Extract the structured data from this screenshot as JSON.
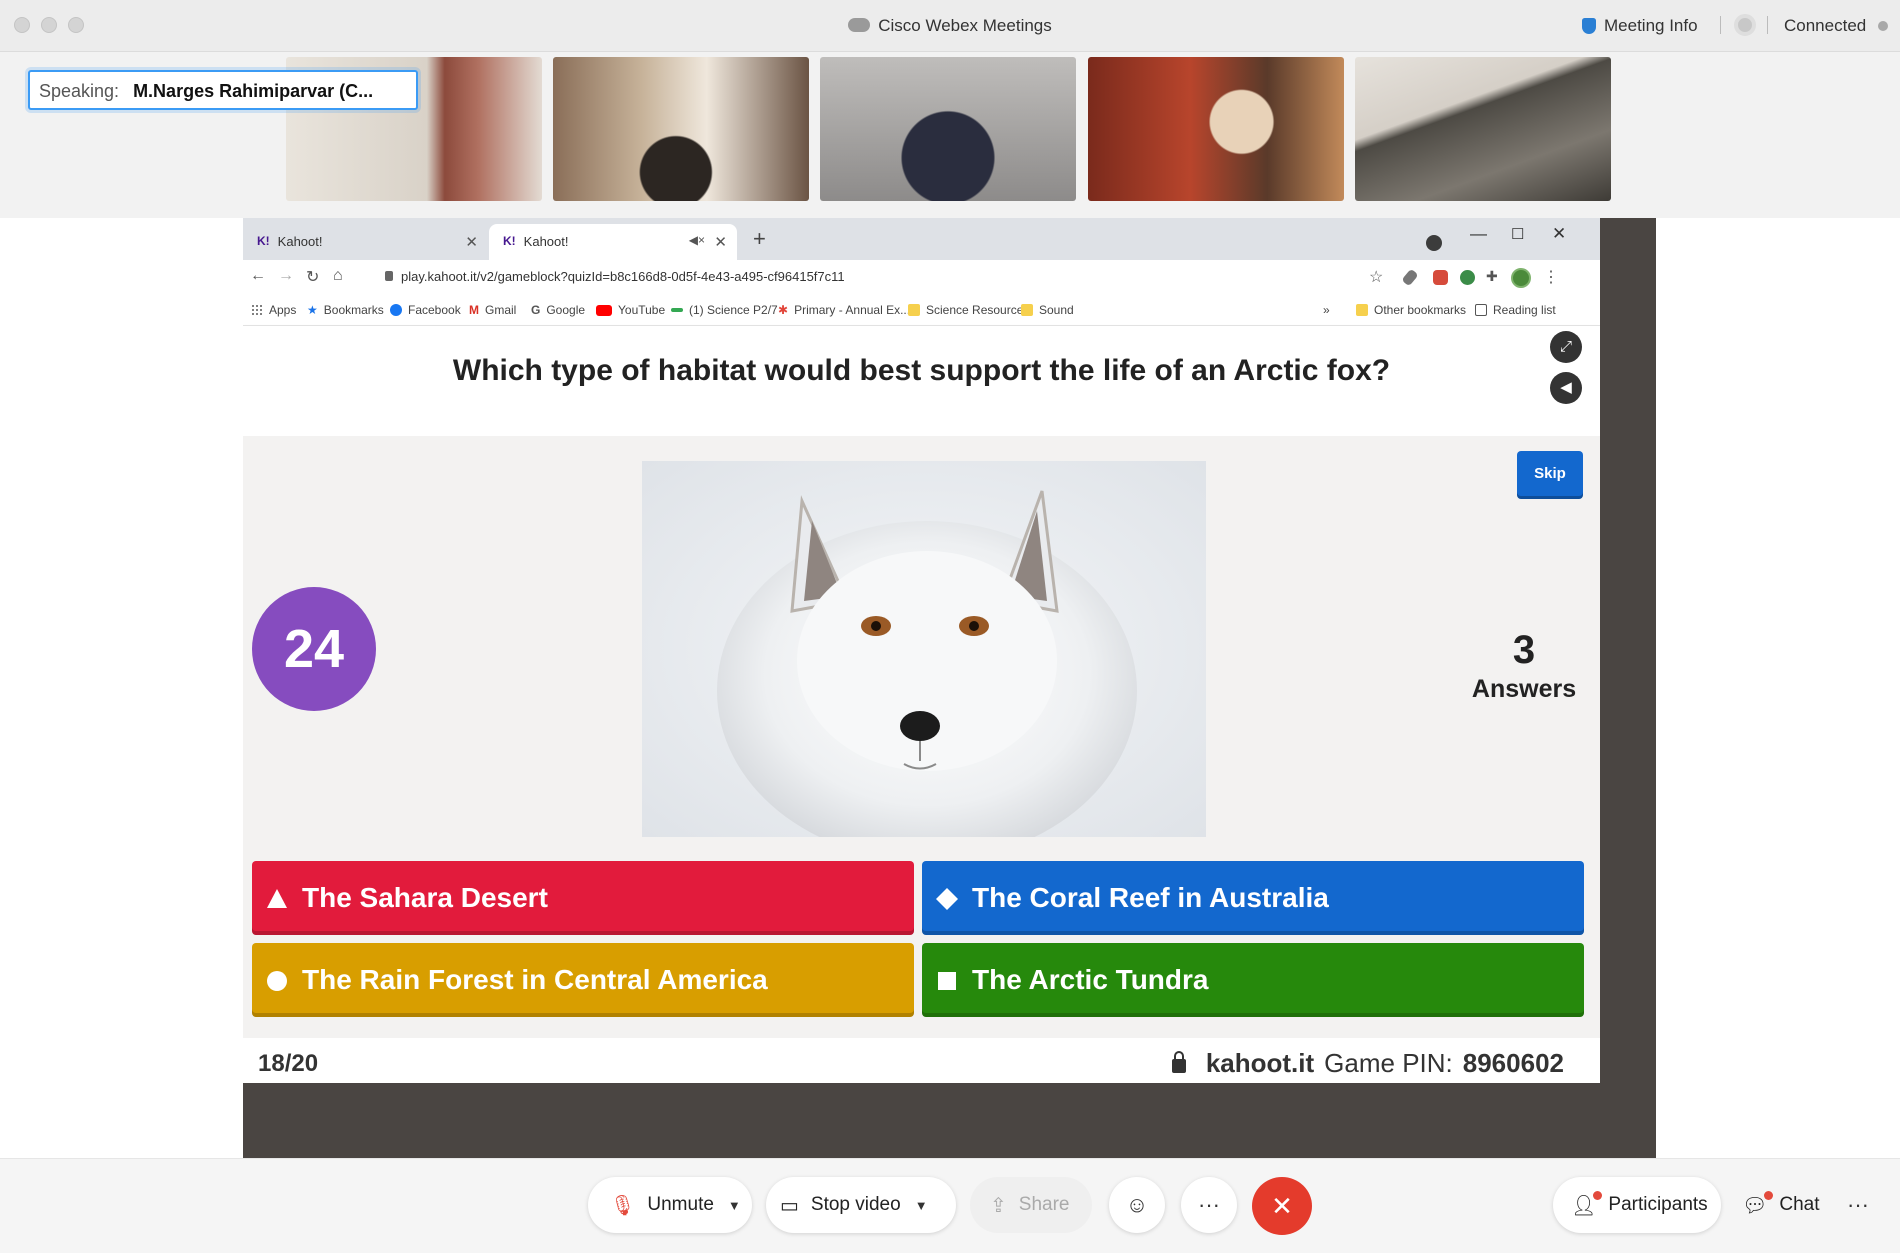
{
  "window": {
    "title": "Cisco Webex Meetings",
    "meeting_info_label": "Meeting Info",
    "status": "Connected"
  },
  "speaking": {
    "label": "Speaking:",
    "name": "M.Narges Rahimiparvar (C..."
  },
  "browser": {
    "tabs": [
      {
        "label": "Kahoot!"
      },
      {
        "label": "Kahoot!"
      }
    ],
    "url": "play.kahoot.it/v2/gameblock?quizId=b8c166d8-0d5f-4e43-a495-cf96415f7c11",
    "bookmarks": [
      "Apps",
      "Bookmarks",
      "Facebook",
      "Gmail",
      "Google",
      "YouTube",
      "(1) Science P2/7",
      "Primary - Annual Ex...",
      "Science Resource",
      "Sound"
    ],
    "bookmarks_more": "»",
    "other_bookmarks": "Other bookmarks",
    "reading_list": "Reading list"
  },
  "kahoot": {
    "question": "Which type of habitat would best support the life of an Arctic fox?",
    "timer": "24",
    "skip_label": "Skip",
    "answers_count": "3",
    "answers_label": "Answers",
    "options": [
      {
        "text": "The Sahara Desert",
        "shape": "triangle-icon",
        "color": "#e21b3c"
      },
      {
        "text": "The Coral Reef in Australia",
        "shape": "diamond-icon",
        "color": "#1368ce"
      },
      {
        "text": "The Rain Forest in Central America",
        "shape": "circle-icon",
        "color": "#d89e00"
      },
      {
        "text": "The Arctic Tundra",
        "shape": "square-icon",
        "color": "#26890c"
      }
    ],
    "progress": "18/20",
    "site": "kahoot.it",
    "pin_label": "Game PIN:",
    "pin": "8960602",
    "timer_color": "#864cbf"
  },
  "controls": {
    "unmute": "Unmute",
    "stop_video": "Stop video",
    "share": "Share",
    "participants": "Participants",
    "chat": "Chat"
  }
}
